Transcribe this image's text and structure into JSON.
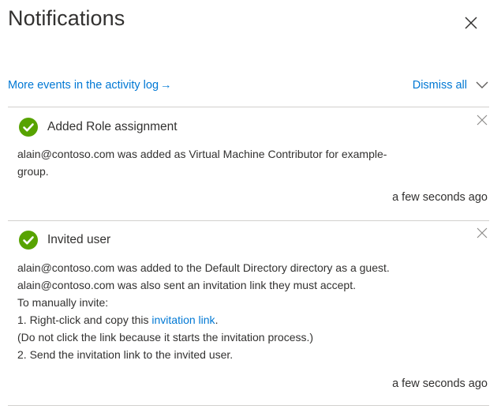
{
  "panel": {
    "title": "Notifications",
    "close_icon": "close-icon"
  },
  "toolbar": {
    "activity_link": "More events in the activity log",
    "activity_arrow": "→",
    "dismiss_all": "Dismiss all",
    "dismiss_icon": "chevron-down-icon"
  },
  "colors": {
    "link": "#0078d4",
    "success": "#57a300",
    "text": "#323130",
    "divider": "#d2d0ce"
  },
  "notifications": [
    {
      "icon": "success-check-icon",
      "title": "Added Role assignment",
      "body_lines": [
        "alain@contoso.com was added as Virtual Machine Contributor for example-",
        "group."
      ],
      "time": "a few seconds ago"
    },
    {
      "icon": "success-check-icon",
      "title": "Invited user",
      "body_lines": [
        "alain@contoso.com was added to the Default Directory directory as a guest.",
        "alain@contoso.com was also sent an invitation link they must accept.",
        "To manually invite:",
        "1. Right-click and copy this ",
        "(Do not click the link because it starts the invitation process.)",
        "2. Send the invitation link to the invited user."
      ],
      "link_text": "invitation link",
      "link_suffix": ".",
      "time": "a few seconds ago"
    }
  ]
}
